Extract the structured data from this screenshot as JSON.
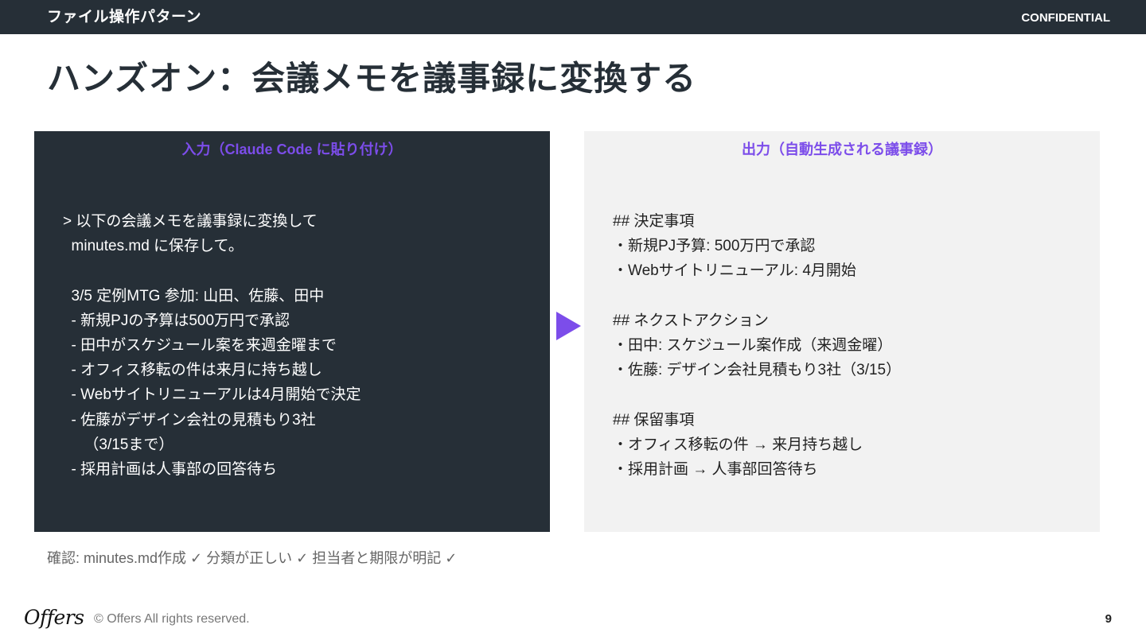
{
  "header": {
    "section": "ファイル操作パターン",
    "confidential": "CONFIDENTIAL"
  },
  "title": "ハンズオン：会議メモを議事録に変換する",
  "input_panel": {
    "heading": "入力（Claude Code に貼り付け）",
    "body": "> 以下の会議メモを議事録に変換して\n  minutes.md に保存して。\n\n  3/5 定例MTG 参加: 山田、佐藤、田中\n  - 新規PJの予算は500万円で承認\n  - 田中がスケジュール案を来週金曜まで\n  - オフィス移転の件は来月に持ち越し\n  - Webサイトリニューアルは4月開始で決定\n  - 佐藤がデザイン会社の見積もり3社\n     （3/15まで）\n  - 採用計画は人事部の回答待ち"
  },
  "output_panel": {
    "heading": "出力（自動生成される議事録）",
    "body": "## 決定事項\n・新規PJ予算: 500万円で承認\n・Webサイトリニューアル: 4月開始\n\n## ネクストアクション\n・田中: スケジュール案作成（来週金曜）\n・佐藤: デザイン会社見積もり3社（3/15）\n\n## 保留事項\n・オフィス移転の件 → 来月持ち越し\n・採用計画 → 人事部回答待ち"
  },
  "checklist": "確認: minutes.md作成 ✓   分類が正しい ✓   担当者と期限が明記 ✓",
  "footer": {
    "logo": "Offers",
    "copyright": "© Offers All rights reserved.",
    "page_number": "9"
  },
  "colors": {
    "dark": "#262f37",
    "accent": "#7c4dea",
    "light_panel": "#f2f2f2"
  }
}
